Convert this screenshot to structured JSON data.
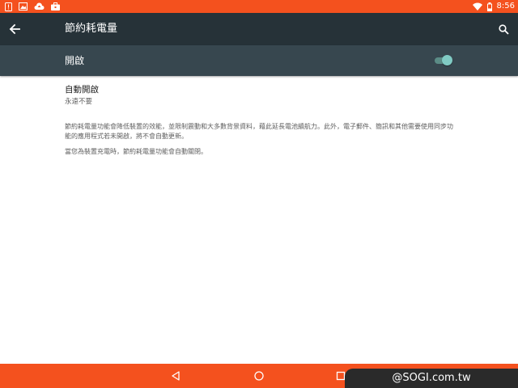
{
  "status_bar": {
    "time": "8:56",
    "left_icons": [
      "alert-icon",
      "image-icon",
      "cloud-upload-icon",
      "briefcase-icon"
    ],
    "right_icons": [
      "wifi-icon",
      "battery-icon"
    ]
  },
  "app_bar": {
    "title": "節約耗電量",
    "back_icon": "arrow-left-icon",
    "search_icon": "search-icon"
  },
  "switch_bar": {
    "label": "開啟",
    "state": "on"
  },
  "settings": {
    "auto_on": {
      "title": "自動開啟",
      "summary": "永遠不要"
    },
    "description_1": "節約耗電量功能會降低裝置的效能，並限制震動和大多數背景資料，藉此延長電池續航力。此外，電子郵件、簡訊和其他需要使用同步功能的應用程式若未開啟，將不會自動更新。",
    "description_2": "當您為裝置充電時，節約耗電量功能會自動關閉。"
  },
  "nav_bar": {
    "buttons": [
      "back-triangle-icon",
      "home-circle-icon",
      "recents-square-icon"
    ]
  },
  "watermark": "@SOGI.com.tw",
  "colors": {
    "status_bar": "#f4511e",
    "app_bar": "#263238",
    "switch_bar": "#37474f",
    "toggle_on": "#80cbc4"
  }
}
